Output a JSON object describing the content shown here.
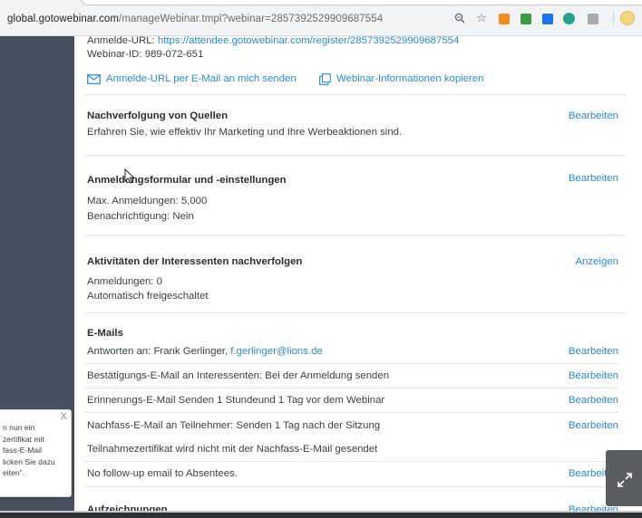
{
  "browser": {
    "url_host": "global.gotowebinar.com",
    "url_path": "/manageWebinar.tmpl?webinar=2857392529909687554"
  },
  "webinar_info": {
    "registration_url_label": "Anmelde-URL:",
    "registration_url": "https://attendee.gotowebinar.com/register/2857392529909687554",
    "webinar_id_label": "Webinar-ID:",
    "webinar_id": "989-072-651",
    "email_url_action": "Anmelde-URL per E-Mail an mich senden",
    "copy_info_action": "Webinar-Informationen kopieren"
  },
  "source_tracking": {
    "title": "Nachverfolgung von Quellen",
    "description": "Erfahren Sie, wie effektiv Ihr Marketing und Ihre Werbeaktionen sind.",
    "edit_label": "Bearbeiten"
  },
  "registration_form": {
    "title": "Anmeldungsformular und -einstellungen",
    "max_registrations": "Max. Anmeldungen: 5,000",
    "notification": "Benachrichtigung: Nein",
    "edit_label": "Bearbeiten"
  },
  "prospect_activity": {
    "title": "Aktivitäten der Interessenten nachverfolgen",
    "registrations": "Anmeldungen: 0",
    "auto_approved": "Automatisch freigeschaltet",
    "view_label": "Anzeigen"
  },
  "emails": {
    "title": "E-Mails",
    "rows": [
      {
        "text": "Antworten an: Frank Gerlinger,",
        "link": "f.gerlinger@lions.de",
        "action": "Bearbeiten"
      },
      {
        "text": "Bestätigungs-E-Mail an Interessenten: Bei der Anmeldung senden",
        "link": "",
        "action": "Bearbeiten"
      },
      {
        "text": "Erinnerungs-E-Mail Senden 1 Stundeund 1 Tag vor dem Webinar",
        "link": "",
        "action": "Bearbeiten"
      },
      {
        "text": "Nachfass-E-Mail an Teilnehmer: Senden 1 Tag nach der Sitzung",
        "link": "",
        "action": "Bearbeiten"
      },
      {
        "text": "Teilnahmezertifikat wird nicht mit der Nachfass-E-Mail gesendet",
        "link": "",
        "action": ""
      },
      {
        "text": "No follow-up email to Absentees.",
        "link": "",
        "action": "Bearbeiten"
      }
    ]
  },
  "recordings": {
    "title": "Aufzeichnungen",
    "edit_label": "Bearbeiten"
  },
  "tooltip": {
    "lines": [
      "n nun ein",
      "zertifikat mit",
      "fass-E-Mail",
      "licken Sie dazu",
      "eiten\"."
    ],
    "close": "X"
  },
  "colors": {
    "sidebar": "#46505e",
    "link": "#2a8bd6",
    "divider": "#e3e5e8"
  }
}
